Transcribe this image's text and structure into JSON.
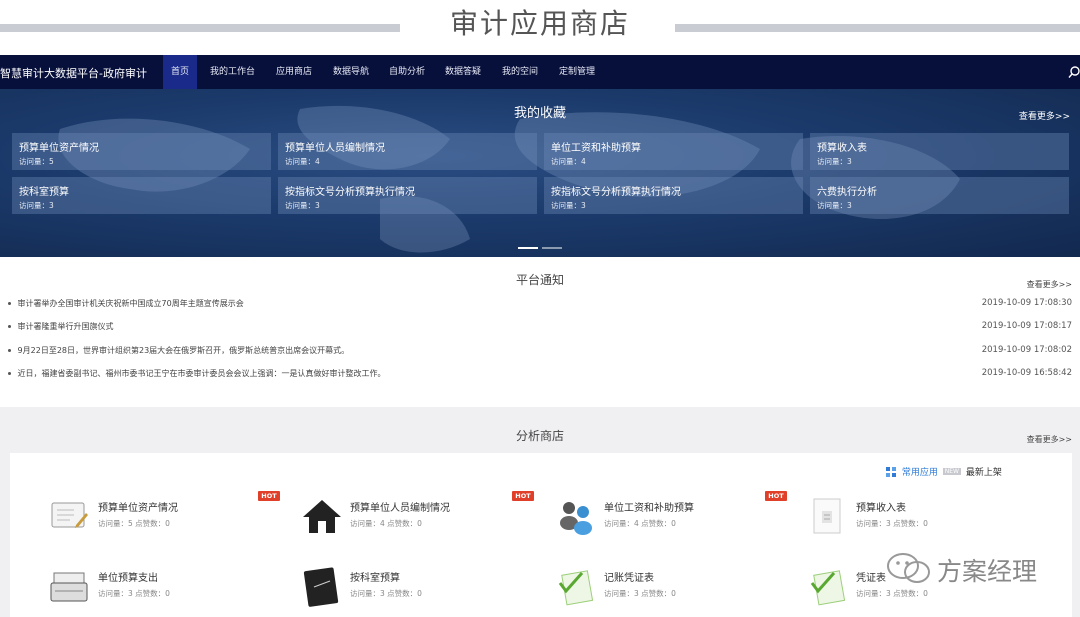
{
  "page_title": "审计应用商店",
  "navbar": {
    "brand": "智慧审计大数据平台-政府审计",
    "items": [
      {
        "label": "首页",
        "active": true
      },
      {
        "label": "我的工作台"
      },
      {
        "label": "应用商店"
      },
      {
        "label": "数据导航"
      },
      {
        "label": "自助分析"
      },
      {
        "label": "数据答疑"
      },
      {
        "label": "我的空间"
      },
      {
        "label": "定制管理"
      }
    ],
    "search_icon": "search-icon"
  },
  "favorites": {
    "title": "我的收藏",
    "more": "查看更多>>",
    "items": [
      {
        "name": "预算单位资产情况",
        "visits": "访问量：5"
      },
      {
        "name": "预算单位人员编制情况",
        "visits": "访问量：4"
      },
      {
        "name": "单位工资和补助预算",
        "visits": "访问量：4"
      },
      {
        "name": "预算收入表",
        "visits": "访问量：3"
      },
      {
        "name": "按科室预算",
        "visits": "访问量：3"
      },
      {
        "name": "按指标文号分析预算执行情况",
        "visits": "访问量：3"
      },
      {
        "name": "按指标文号分析预算执行情况",
        "visits": "访问量：3"
      },
      {
        "name": "六费执行分析",
        "visits": "访问量：3"
      }
    ]
  },
  "notices": {
    "title": "平台通知",
    "more": "查看更多>>",
    "items": [
      {
        "text": "审计署举办全国审计机关庆祝新中国成立70周年主题宣传展示会",
        "time": "2019-10-09 17:08:30"
      },
      {
        "text": "审计署隆重举行升国旗仪式",
        "time": "2019-10-09 17:08:17"
      },
      {
        "text": "9月22日至28日，世界审计组织第23届大会在俄罗斯召开，俄罗斯总统普京出席会议开幕式。",
        "time": "2019-10-09 17:08:02"
      },
      {
        "text": "近日，福建省委副书记、福州市委书记王宁在市委审计委员会会议上强调：一是认真做好审计整改工作。",
        "time": "2019-10-09 16:58:42"
      }
    ]
  },
  "shop": {
    "title": "分析商店",
    "more": "查看更多>>",
    "filter_common": "常用应用",
    "filter_tag": "NEW",
    "filter_latest": "最新上架",
    "hot_label": "HOT",
    "apps": [
      {
        "name": "预算单位资产情况",
        "stats": "访问量：5 点赞数：0",
        "hot": true,
        "icon": "form-pen-icon"
      },
      {
        "name": "预算单位人员编制情况",
        "stats": "访问量：4 点赞数：0",
        "hot": true,
        "icon": "house-icon"
      },
      {
        "name": "单位工资和补助预算",
        "stats": "访问量：4 点赞数：0",
        "hot": true,
        "icon": "people-group-icon"
      },
      {
        "name": "预算收入表",
        "stats": "访问量：3 点赞数：0",
        "hot": false,
        "icon": "document-icon"
      },
      {
        "name": "单位预算支出",
        "stats": "访问量：3 点赞数：0",
        "hot": false,
        "icon": "cash-register-icon"
      },
      {
        "name": "按科室预算",
        "stats": "访问量：3 点赞数：0",
        "hot": false,
        "icon": "notebook-icon"
      },
      {
        "name": "记账凭证表",
        "stats": "访问量：3 点赞数：0",
        "hot": false,
        "icon": "checklist-icon"
      },
      {
        "name": "凭证表",
        "stats": "访问量：3 点赞数：0",
        "hot": false,
        "icon": "checklist-icon"
      }
    ]
  },
  "watermark": "方案经理",
  "colors": {
    "navbar_bg": "#070f3b",
    "nav_active": "#1a2a8a",
    "hero_bg": "#1b3a6b",
    "hot_badge": "#e0402a",
    "link_blue": "#2f7bd6"
  }
}
